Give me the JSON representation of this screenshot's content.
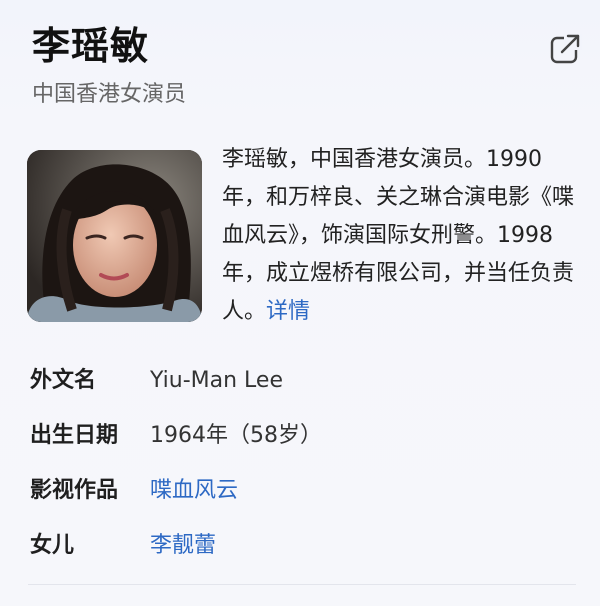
{
  "entity": {
    "name": "李瑶敏",
    "subtitle": "中国香港女演员"
  },
  "summary": {
    "text": "李瑶敏，中国香港女演员。1990年，和万梓良、关之琳合演电影《喋血风云》，饰演国际女刑警。1998年，成立煜桥有限公司，并当任负责人。",
    "more_link": "详情"
  },
  "info": {
    "foreign_name": {
      "label": "外文名",
      "value": "Yiu-Man Lee"
    },
    "birth_date": {
      "label": "出生日期",
      "value": "1964年（58岁）"
    },
    "works": {
      "label": "影视作品",
      "value": "喋血风云"
    },
    "daughter": {
      "label": "女儿",
      "value": "李靓蕾"
    }
  },
  "colors": {
    "link": "#2d69c4",
    "background": "#f4f5fa"
  },
  "icons": {
    "share": "share-external-icon"
  }
}
